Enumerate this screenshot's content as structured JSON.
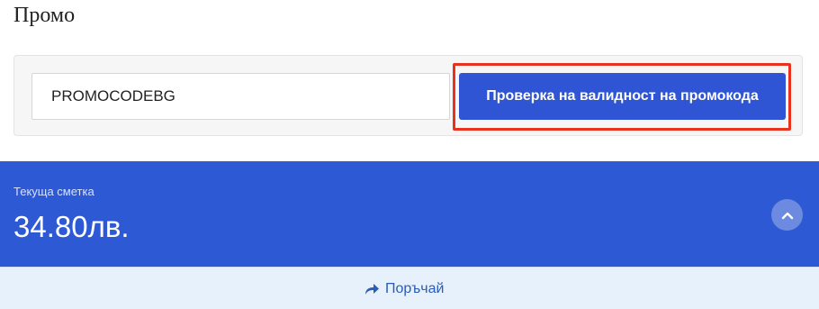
{
  "promo": {
    "title": "Промо",
    "input_value": "PROMOCODEBG",
    "check_button_label": "Проверка на валидност на промокода"
  },
  "total": {
    "label": "Текуща сметка",
    "value": "34.80лв."
  },
  "order": {
    "label": "Поръчай"
  },
  "icons": {
    "collapse": "chevron-up-icon",
    "order": "arrow-right-icon"
  },
  "colors": {
    "primary": "#2f55d4",
    "total_bar": "#2e59d4",
    "highlight": "#e8321e",
    "order_bar": "#e7f1fb",
    "order_link": "#2a5cb8"
  }
}
